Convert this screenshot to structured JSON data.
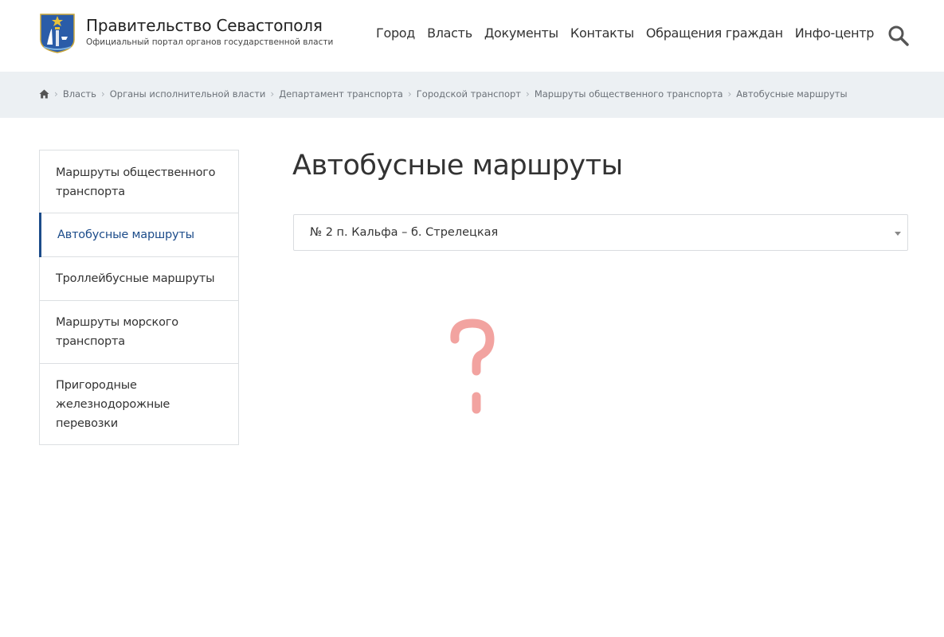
{
  "header": {
    "title": "Правительство Севастополя",
    "subtitle": "Официальный портал органов государственной власти"
  },
  "nav": [
    {
      "label": "Город"
    },
    {
      "label": "Власть"
    },
    {
      "label": "Документы"
    },
    {
      "label": "Контакты"
    },
    {
      "label": "Обращения граждан"
    },
    {
      "label": "Инфо-центр"
    }
  ],
  "breadcrumb": [
    {
      "label": "Власть"
    },
    {
      "label": "Органы исполнительной власти"
    },
    {
      "label": "Департамент транспорта"
    },
    {
      "label": "Городской транспорт"
    },
    {
      "label": "Маршруты общественного транспорта"
    },
    {
      "label": "Автобусные маршруты"
    }
  ],
  "sidebar": {
    "items": [
      {
        "label": "Маршруты общественного транспорта"
      },
      {
        "label": "Автобусные маршруты",
        "active": true
      },
      {
        "label": "Троллейбусные маршруты"
      },
      {
        "label": "Маршруты морского транспорта"
      },
      {
        "label": "Пригородные железнодорожные перевозки"
      }
    ]
  },
  "main": {
    "title": "Автобусные маршруты",
    "route_select": {
      "selected": "№ 2 п. Кальфа – б. Стрелецкая"
    },
    "placeholder_icon": "question-mark-icon"
  },
  "colors": {
    "accent": "#1c4c8a",
    "breadcrumb_bg": "#ecf0f3",
    "border": "#dcdfe2",
    "placeholder": "#f2a3a0"
  }
}
